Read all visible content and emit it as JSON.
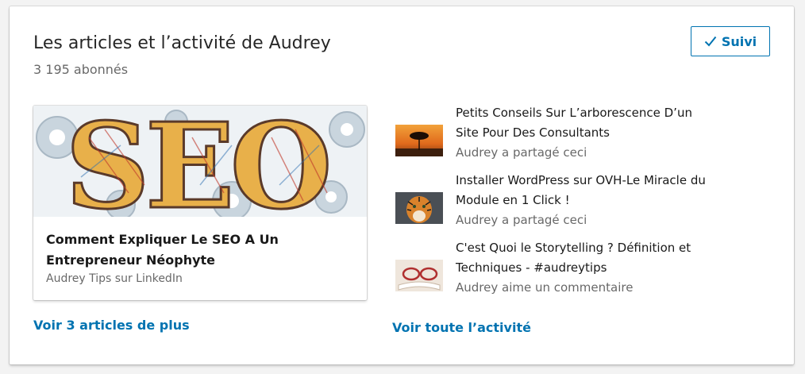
{
  "header": {
    "title": "Les articles et l’activité de Audrey",
    "followers": "3 195 abonnés"
  },
  "follow_button": {
    "icon": "check-icon",
    "label": "Suivi",
    "accent_color": "#0073b1"
  },
  "featured_article": {
    "image_text": "SEO",
    "title": "Comment Expliquer Le SEO A Un Entrepreneur Néophyte",
    "source": "Audrey Tips sur LinkedIn"
  },
  "more_articles_link": "Voir 3 articles de plus",
  "activity": {
    "items": [
      {
        "thumb": "sunset-tree-thumbnail",
        "title": "Petits Conseils Sur L’arborescence D’un Site Pour Des Consultants",
        "meta": "Audrey a partagé ceci"
      },
      {
        "thumb": "tiger-thumbnail",
        "title": "Installer WordPress sur OVH-Le Miracle du Module en 1 Click !",
        "meta": "Audrey a partagé ceci"
      },
      {
        "thumb": "glasses-book-thumbnail",
        "title": "C'est Quoi le Storytelling ? Définition et Techniques - #audreytips",
        "meta": "Audrey aime un commentaire"
      }
    ],
    "see_all_link": "Voir toute l’activité"
  }
}
